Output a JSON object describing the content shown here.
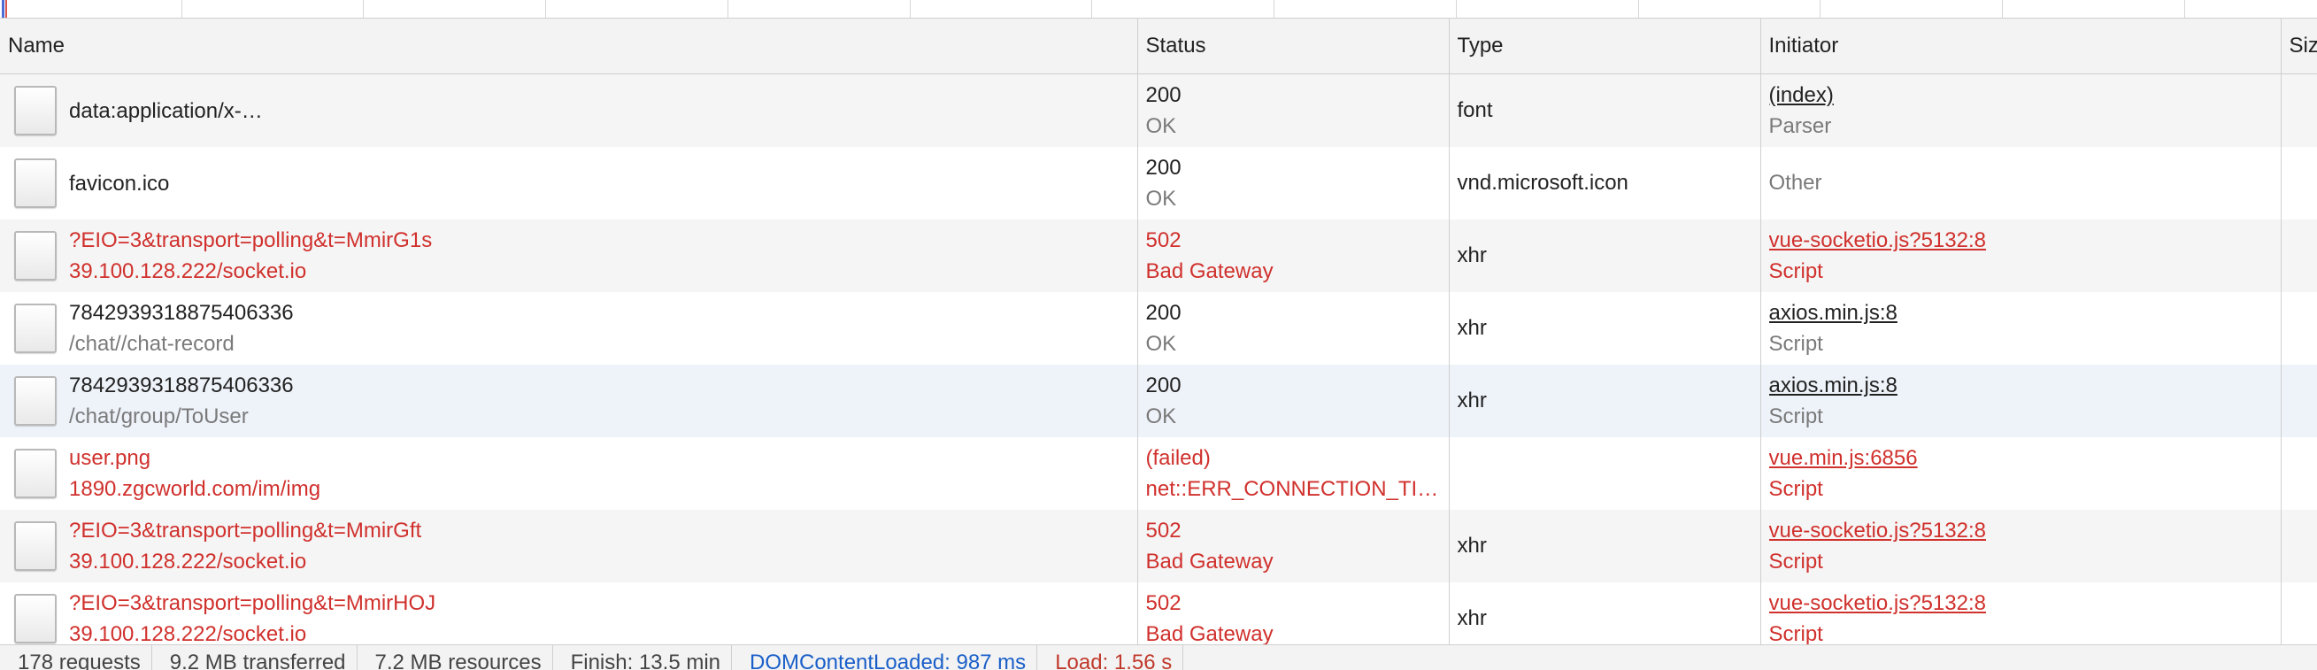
{
  "columns": {
    "name": "Name",
    "status": "Status",
    "type": "Type",
    "initiator": "Initiator",
    "size": "Size"
  },
  "rows": [
    {
      "name": "data:application/x-…",
      "path": "",
      "status_code": "200",
      "status_text": "OK",
      "type": "font",
      "initiator": "(index)",
      "initiator_sub": "Parser",
      "error": false
    },
    {
      "name": "favicon.ico",
      "path": "",
      "status_code": "200",
      "status_text": "OK",
      "type": "vnd.microsoft.icon",
      "initiator": "",
      "initiator_sub": "Other",
      "error": false
    },
    {
      "name": "?EIO=3&transport=polling&t=MmirG1s",
      "path": "39.100.128.222/socket.io",
      "status_code": "502",
      "status_text": "Bad Gateway",
      "type": "xhr",
      "initiator": "vue-socketio.js?5132:8",
      "initiator_sub": "Script",
      "error": true
    },
    {
      "name": "7842939318875406336",
      "path": "/chat//chat-record",
      "status_code": "200",
      "status_text": "OK",
      "type": "xhr",
      "initiator": "axios.min.js:8",
      "initiator_sub": "Script",
      "error": false
    },
    {
      "name": "7842939318875406336",
      "path": "/chat/group/ToUser",
      "status_code": "200",
      "status_text": "OK",
      "type": "xhr",
      "initiator": "axios.min.js:8",
      "initiator_sub": "Script",
      "error": false
    },
    {
      "name": "user.png",
      "path": "1890.zgcworld.com/im/img",
      "status_code": "(failed)",
      "status_text": "net::ERR_CONNECTION_TI…",
      "type": "",
      "initiator": "vue.min.js:6856",
      "initiator_sub": "Script",
      "error": true
    },
    {
      "name": "?EIO=3&transport=polling&t=MmirGft",
      "path": "39.100.128.222/socket.io",
      "status_code": "502",
      "status_text": "Bad Gateway",
      "type": "xhr",
      "initiator": "vue-socketio.js?5132:8",
      "initiator_sub": "Script",
      "error": true
    },
    {
      "name": "?EIO=3&transport=polling&t=MmirHOJ",
      "path": "39.100.128.222/socket.io",
      "status_code": "502",
      "status_text": "Bad Gateway",
      "type": "xhr",
      "initiator": "vue-socketio.js?5132:8",
      "initiator_sub": "Script",
      "error": true
    }
  ],
  "summary": {
    "requests": "178 requests",
    "transferred": "9.2 MB transferred",
    "resources": "7.2 MB resources",
    "finish": "Finish: 13.5 min",
    "dom_content_loaded": "DOMContentLoaded: 987 ms",
    "load": "Load: 1.56 s"
  },
  "colors": {
    "error": "#d0312d",
    "dom_content_loaded": "#1a5fc9",
    "load": "#c0392b",
    "selected_row": "#eef2f9"
  }
}
